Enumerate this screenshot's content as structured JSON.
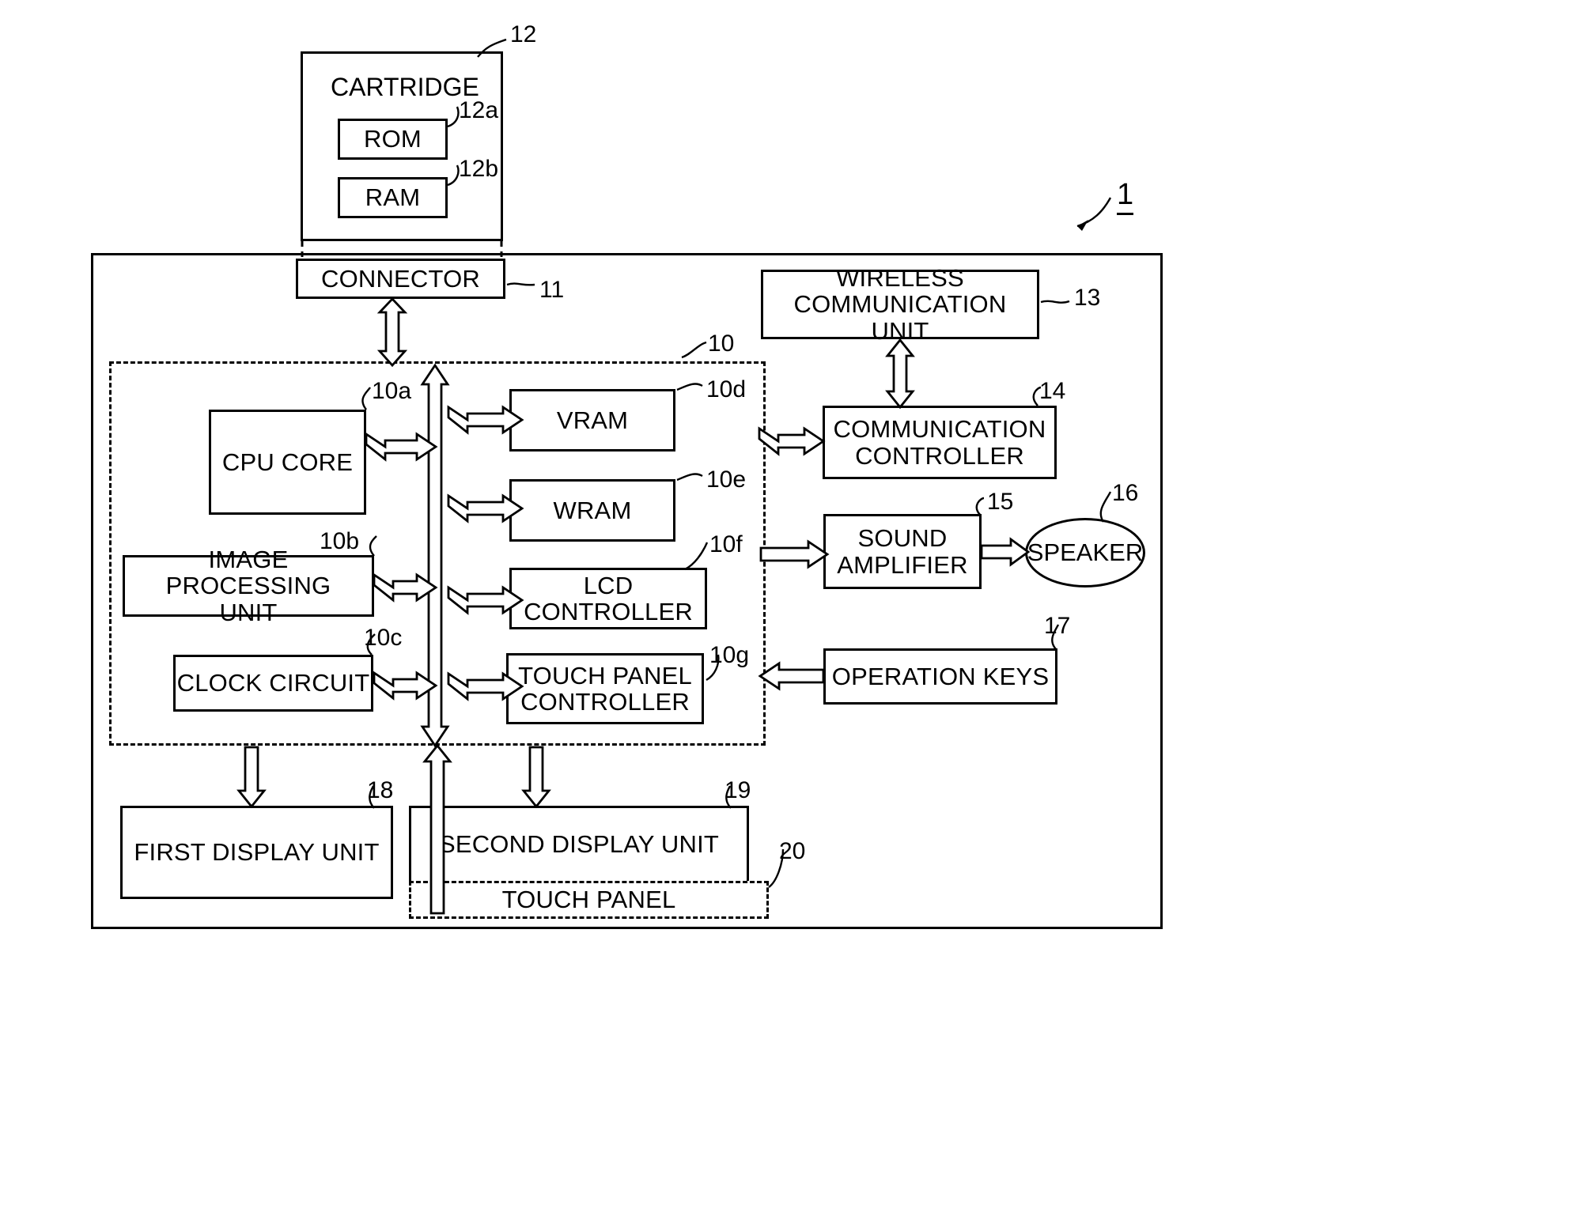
{
  "figure": {
    "system_ref": "1",
    "blocks": {
      "cartridge": {
        "label": "CARTRIDGE",
        "ref": "12"
      },
      "rom": {
        "label": "ROM",
        "ref": "12a"
      },
      "ram": {
        "label": "RAM",
        "ref": "12b"
      },
      "connector": {
        "label": "CONNECTOR",
        "ref": "11"
      },
      "electronic_circuit": {
        "label": "",
        "ref": "10"
      },
      "cpu_core": {
        "label": "CPU CORE",
        "ref": "10a"
      },
      "image_processing": {
        "label": "IMAGE PROCESSING UNIT",
        "ref": "10b"
      },
      "clock_circuit": {
        "label": "CLOCK CIRCUIT",
        "ref": "10c"
      },
      "vram": {
        "label": "VRAM",
        "ref": "10d"
      },
      "wram": {
        "label": "WRAM",
        "ref": "10e"
      },
      "lcd_controller": {
        "label": "LCD CONTROLLER",
        "ref": "10f"
      },
      "touch_panel_controller": {
        "label": "TOUCH PANEL CONTROLLER",
        "ref": "10g"
      },
      "wireless_comm_unit": {
        "label": "WIRELESS COMMUNICATION UNIT",
        "ref": "13"
      },
      "comm_controller": {
        "label": "COMMUNICATION CONTROLLER",
        "ref": "14"
      },
      "sound_amplifier": {
        "label": "SOUND AMPLIFIER",
        "ref": "15"
      },
      "speaker": {
        "label": "SPEAKER",
        "ref": "16"
      },
      "operation_keys": {
        "label": "OPERATION KEYS",
        "ref": "17"
      },
      "first_display_unit": {
        "label": "FIRST DISPLAY UNIT",
        "ref": "18"
      },
      "second_display_unit": {
        "label": "SECOND DISPLAY UNIT",
        "ref": "19"
      },
      "touch_panel": {
        "label": "TOUCH PANEL",
        "ref": "20"
      }
    },
    "block_text": {
      "image_processing_line1": "IMAGE PROCESSING",
      "image_processing_line2": "UNIT",
      "touch_panel_controller_line1": "TOUCH PANEL",
      "touch_panel_controller_line2": "CONTROLLER",
      "wireless_line1": "WIRELESS",
      "wireless_line2": "COMMUNICATION UNIT",
      "comm_controller_line1": "COMMUNICATION",
      "comm_controller_line2": "CONTROLLER",
      "sound_amp_line1": "SOUND",
      "sound_amp_line2": "AMPLIFIER"
    },
    "colors": {
      "line": "#000000",
      "background": "#ffffff",
      "fill": "#ffffff"
    }
  }
}
